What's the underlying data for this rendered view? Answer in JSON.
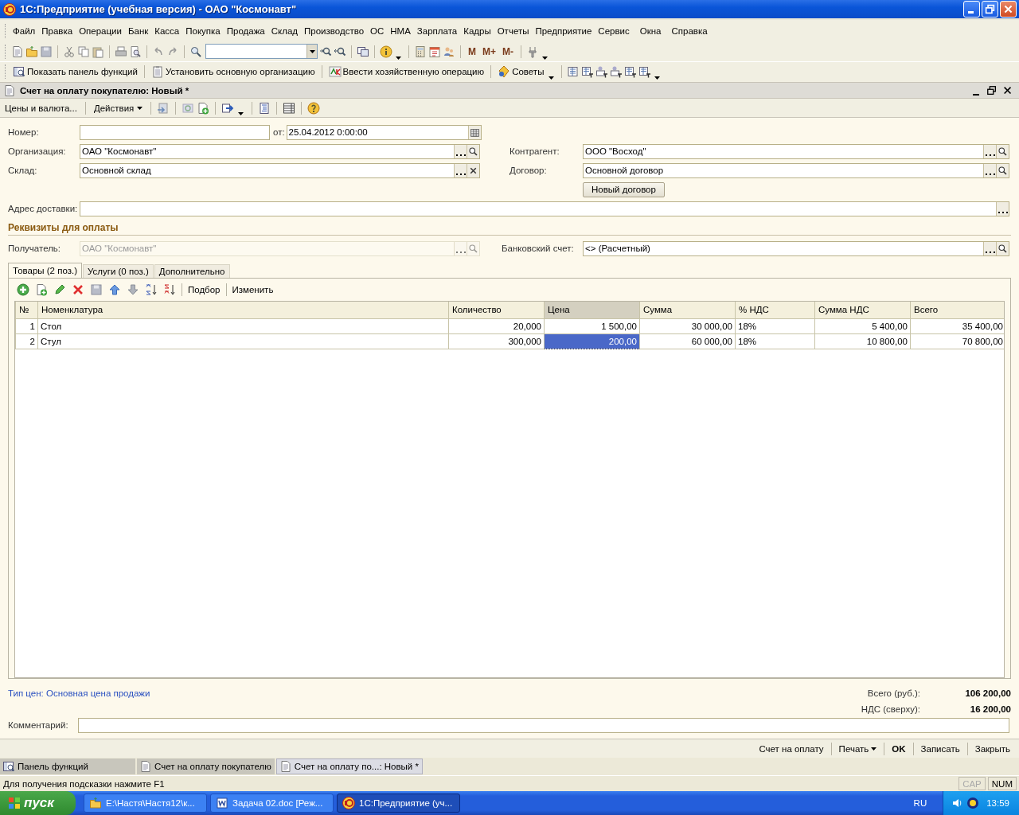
{
  "window": {
    "title": "1С:Предприятие (учебная версия) - ОАО \"Космонавт\""
  },
  "menu": [
    {
      "label": "Файл"
    },
    {
      "label": "Правка"
    },
    {
      "label": "Операции"
    },
    {
      "label": "Банк"
    },
    {
      "label": "Касса"
    },
    {
      "label": "Покупка"
    },
    {
      "label": "Продажа"
    },
    {
      "label": "Склад"
    },
    {
      "label": "Производство"
    },
    {
      "label": "ОС"
    },
    {
      "label": "НМА"
    },
    {
      "label": "Зарплата"
    },
    {
      "label": "Кадры"
    },
    {
      "label": "Отчеты"
    },
    {
      "label": "Предприятие"
    },
    {
      "label": "Сервис"
    },
    {
      "label": "Окна"
    },
    {
      "label": "Справка"
    }
  ],
  "toolbar": {
    "memory_buttons": [
      "M",
      "M+",
      "M-"
    ]
  },
  "function_toolbar": [
    {
      "label": "Показать панель функций"
    },
    {
      "label": "Установить основную организацию"
    },
    {
      "label": "Ввести хозяйственную операцию"
    },
    {
      "label": "Советы"
    }
  ],
  "document": {
    "title": "Счет на оплату покупателю: Новый *",
    "toolbar": [
      {
        "label": "Цены и валюта...",
        "dropdown": false
      },
      {
        "label": "Действия",
        "dropdown": true
      }
    ],
    "number": {
      "label": "Номер:"
    },
    "date": {
      "label": "от:",
      "value": "25.04.2012  0:00:00"
    },
    "organization": {
      "label": "Организация:",
      "value": "ОАО \"Космонавт\""
    },
    "warehouse": {
      "label": "Склад:",
      "value": "Основной склад"
    },
    "counterparty": {
      "label": "Контрагент:",
      "value": "ООО \"Восход\""
    },
    "contract": {
      "label": "Договор:",
      "value": "Основной договор"
    },
    "new_contract_button": "Новый договор",
    "delivery_address": {
      "label": "Адрес доставки:"
    },
    "payment_section": "Реквизиты для оплаты",
    "recipient": {
      "label": "Получатель:",
      "value": "ОАО \"Космонавт\"",
      "disabled": true
    },
    "bank_account": {
      "label": "Банковский счет:",
      "value": "<> (Расчетный)",
      "disabled": false
    },
    "tabs": [
      {
        "label": "Товары (2 поз.)",
        "selected": true
      },
      {
        "label": "Услуги (0 поз.)",
        "selected": false
      },
      {
        "label": "Дополнительно",
        "selected": false
      }
    ],
    "table_toolbar": [
      "Подбор",
      "Изменить"
    ],
    "table": {
      "columns": [
        {
          "label": "№",
          "selected": false
        },
        {
          "label": "Номенклатура",
          "selected": false
        },
        {
          "label": "Количество",
          "selected": false
        },
        {
          "label": "Цена",
          "selected": true
        },
        {
          "label": "Сумма",
          "selected": false
        },
        {
          "label": "% НДС",
          "selected": false
        },
        {
          "label": "Сумма НДС",
          "selected": false
        },
        {
          "label": "Всего",
          "selected": false
        }
      ],
      "rows": [
        {
          "selected": false,
          "cells": [
            "1",
            "Стол",
            "20,000",
            "1 500,00",
            "30 000,00",
            "18%",
            "5 400,00",
            "35 400,00"
          ]
        },
        {
          "selected": true,
          "cells": [
            "2",
            "Стул",
            "300,000",
            "200,00",
            "60 000,00",
            "18%",
            "10 800,00",
            "70 800,00"
          ]
        }
      ]
    },
    "price_type": "Тип цен: Основная цена продажи",
    "totals": [
      {
        "label": "Всего (руб.):",
        "value": "106 200,00"
      },
      {
        "label": "НДС (сверху):",
        "value": "16 200,00"
      }
    ],
    "comment": {
      "label": "Комментарий:"
    },
    "buttons": [
      {
        "label": "Счет на оплату",
        "kind": "plain"
      },
      {
        "label": "Печать",
        "kind": "menu"
      },
      {
        "label": "OK",
        "kind": "default"
      },
      {
        "label": "Записать",
        "kind": "plain"
      },
      {
        "label": "Закрыть",
        "kind": "plain"
      }
    ]
  },
  "window_tabs": [
    {
      "label": "Панель функций",
      "kind": "panel",
      "selected": false
    },
    {
      "label": "Счет на оплату покупателю",
      "kind": "document",
      "selected": false
    },
    {
      "label": "Счет на оплату по...: Новый *",
      "kind": "document",
      "selected": true
    }
  ],
  "status_bar": {
    "hint": "Для получения подсказки нажмите F1",
    "indicators": [
      {
        "label": "CAP",
        "on": false
      },
      {
        "label": "NUM",
        "on": true
      }
    ]
  },
  "taskbar": {
    "start": "пуск",
    "tasks": [
      {
        "label": "E:\\Настя\\Настя12\\к...",
        "kind": "folder",
        "selected": false
      },
      {
        "label": "Задача 02.doc [Реж...",
        "kind": "word",
        "selected": false
      },
      {
        "label": "1С:Предприятие (уч...",
        "kind": "app",
        "selected": true
      }
    ],
    "language": "RU",
    "clock": "13:59"
  }
}
